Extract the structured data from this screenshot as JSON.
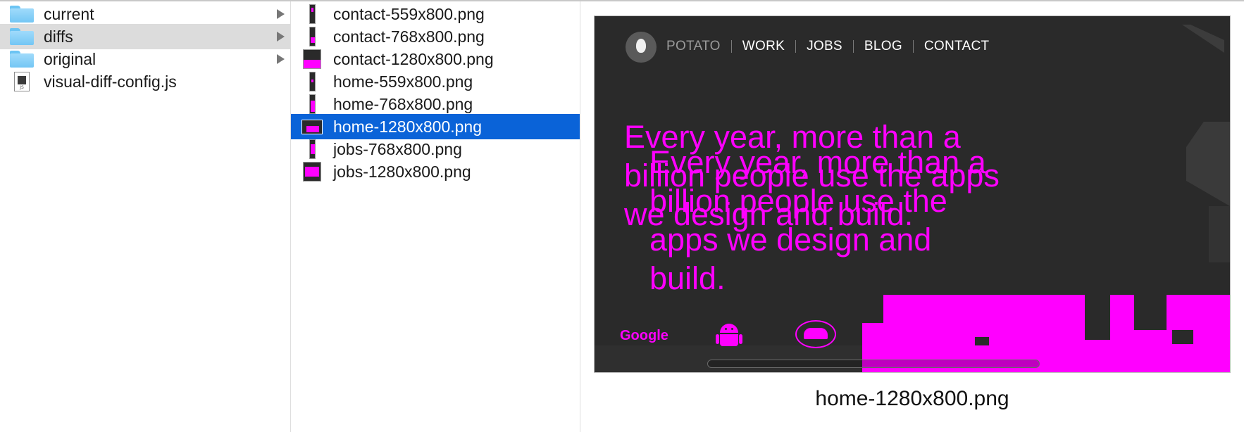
{
  "column1": {
    "items": [
      {
        "label": "current",
        "icon": "folder-icon",
        "has_children": true
      },
      {
        "label": "diffs",
        "icon": "folder-icon",
        "has_children": true,
        "highlighted": true
      },
      {
        "label": "original",
        "icon": "folder-icon",
        "has_children": true
      },
      {
        "label": "visual-diff-config.js",
        "icon": "js-file-icon",
        "icon_text": "JS",
        "has_children": false
      }
    ]
  },
  "column2": {
    "items": [
      {
        "label": "contact-559x800.png"
      },
      {
        "label": "contact-768x800.png"
      },
      {
        "label": "contact-1280x800.png"
      },
      {
        "label": "home-559x800.png"
      },
      {
        "label": "home-768x800.png"
      },
      {
        "label": "home-1280x800.png",
        "selected": true
      },
      {
        "label": "jobs-768x800.png"
      },
      {
        "label": "jobs-1280x800.png"
      }
    ]
  },
  "preview": {
    "nav": {
      "brand": "POTATO",
      "items": [
        "WORK",
        "JOBS",
        "BLOG",
        "CONTACT"
      ]
    },
    "headline": "Every year, more than a billion people use the apps we design and build.",
    "footer_logo": "Google",
    "filename": "home-1280x800.png"
  },
  "colors": {
    "selection": "#0a63d8",
    "hover_row": "#dcdcdc",
    "diff_magenta": "#ff00ff",
    "preview_background": "#2a2a2a",
    "folder": "#73c6f4"
  }
}
